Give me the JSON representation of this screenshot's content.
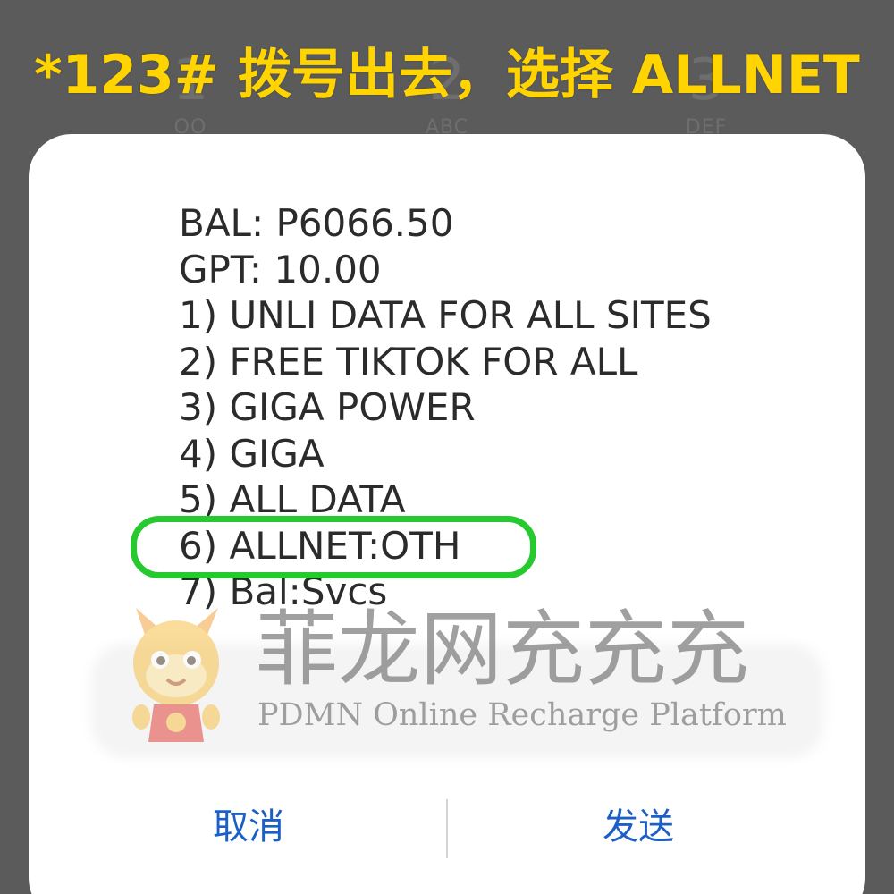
{
  "banner": {
    "text": "*123# 拨号出去，选择 ALLNET",
    "color": "#ffd400"
  },
  "dialer": {
    "keys": [
      {
        "digit": "1",
        "letters": "OO"
      },
      {
        "digit": "2",
        "letters": "ABC"
      },
      {
        "digit": "3",
        "letters": "DEF"
      }
    ]
  },
  "dialog": {
    "lines": [
      "BAL: P6066.50",
      "GPT: 10.00",
      "1) UNLI DATA FOR ALL SITES",
      "2) FREE TIKTOK FOR ALL",
      "3) GIGA POWER",
      "4) GIGA",
      "5) ALL DATA",
      "6) ALLNET:OTH",
      "7) Bal:Svcs"
    ],
    "highlighted_option": "6) ALLNET:OTH",
    "highlight_color": "#26c92e",
    "cancel_label": "取消",
    "send_label": "发送",
    "button_color": "#1c5fc7"
  },
  "watermark": {
    "title": "菲龙网充充充",
    "subtitle": "PDMN Online Recharge Platform",
    "mascot": "dragon-mascot-icon"
  }
}
